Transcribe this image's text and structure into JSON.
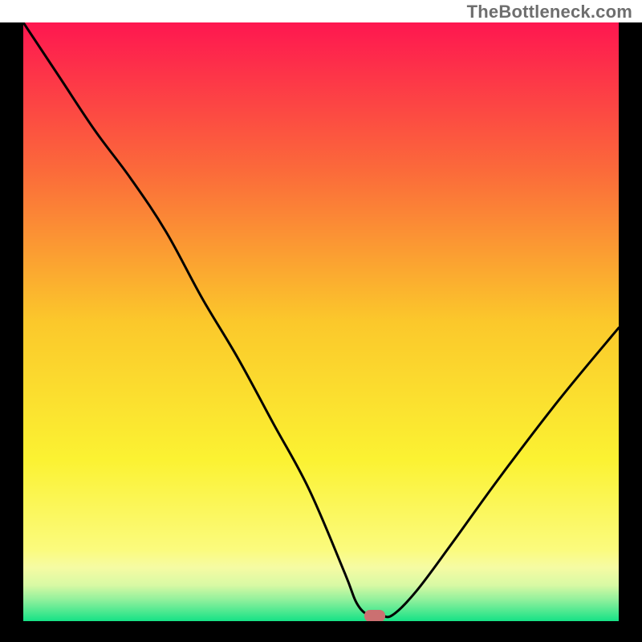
{
  "attribution": "TheBottleneck.com",
  "chart_data": {
    "type": "line",
    "title": "",
    "xlabel": "",
    "ylabel": "",
    "xlim": [
      0,
      100
    ],
    "ylim": [
      0,
      100
    ],
    "series": [
      {
        "name": "bottleneck-curve",
        "x": [
          0,
          6,
          12,
          18,
          24,
          30,
          36,
          42,
          48,
          54,
          56,
          58,
          60,
          62,
          66,
          72,
          80,
          90,
          100
        ],
        "y": [
          100,
          91,
          82,
          74,
          65,
          54,
          44,
          33,
          22,
          8,
          3,
          1,
          1,
          1,
          5,
          13,
          24,
          37,
          49
        ]
      }
    ],
    "marker": {
      "x": 59,
      "y": 1
    },
    "background": {
      "gradient_stops": [
        {
          "pos": 0.0,
          "color": "#fe1750"
        },
        {
          "pos": 0.25,
          "color": "#fb6b3a"
        },
        {
          "pos": 0.5,
          "color": "#fbc82b"
        },
        {
          "pos": 0.73,
          "color": "#fbf232"
        },
        {
          "pos": 0.88,
          "color": "#fbfb7d"
        },
        {
          "pos": 0.91,
          "color": "#f6fba3"
        },
        {
          "pos": 0.94,
          "color": "#d8f9a4"
        },
        {
          "pos": 0.965,
          "color": "#8ef09c"
        },
        {
          "pos": 1.0,
          "color": "#16e286"
        }
      ]
    }
  }
}
